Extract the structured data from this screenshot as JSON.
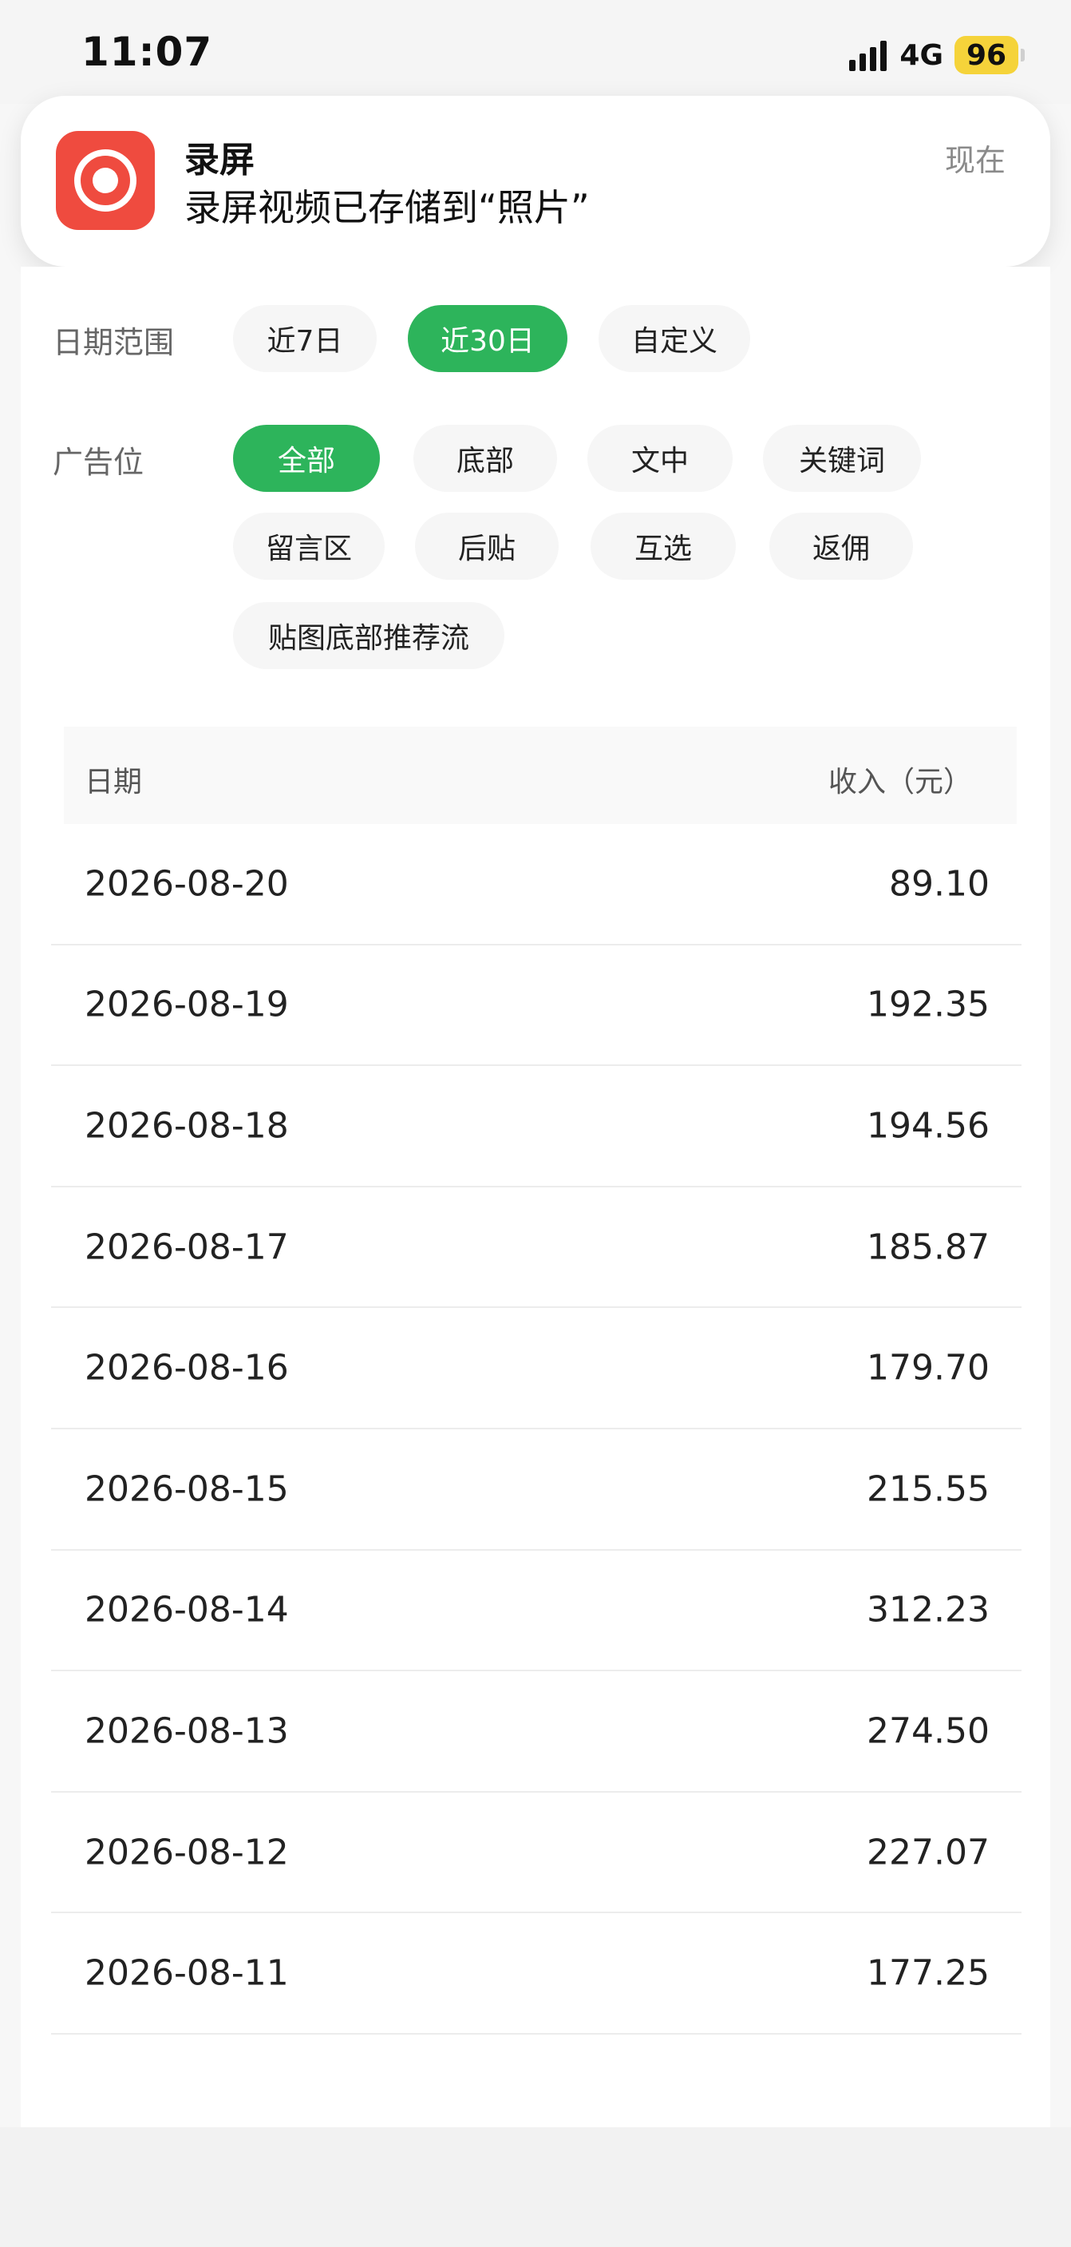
{
  "status_bar": {
    "time": "11:07",
    "network": "4G",
    "battery": "96",
    "icons": [
      "signal-icon",
      "battery-icon"
    ]
  },
  "notification": {
    "app_name": "录屏",
    "message": "录屏视频已存储到“照片”",
    "time": "现在",
    "icon": "record-icon",
    "icon_color": "#ef4b3f"
  },
  "filters": {
    "date_range": {
      "label": "日期范围",
      "options": [
        "近7日",
        "近30日",
        "自定义"
      ],
      "selected": "近30日"
    },
    "ad_slot": {
      "label": "广告位",
      "options": [
        "全部",
        "底部",
        "文中",
        "关键词",
        "留言区",
        "后贴",
        "互选",
        "返佣",
        "贴图底部推荐流"
      ],
      "selected": "全部"
    },
    "accent_color": "#2db45b"
  },
  "table": {
    "headers": {
      "date": "日期",
      "income": "收入（元）"
    },
    "rows": [
      {
        "date": "2026-08-20",
        "income": "89.10"
      },
      {
        "date": "2026-08-19",
        "income": "192.35"
      },
      {
        "date": "2026-08-18",
        "income": "194.56"
      },
      {
        "date": "2026-08-17",
        "income": "185.87"
      },
      {
        "date": "2026-08-16",
        "income": "179.70"
      },
      {
        "date": "2026-08-15",
        "income": "215.55"
      },
      {
        "date": "2026-08-14",
        "income": "312.23"
      },
      {
        "date": "2026-08-13",
        "income": "274.50"
      },
      {
        "date": "2026-08-12",
        "income": "227.07"
      },
      {
        "date": "2026-08-11",
        "income": "177.25"
      }
    ]
  }
}
